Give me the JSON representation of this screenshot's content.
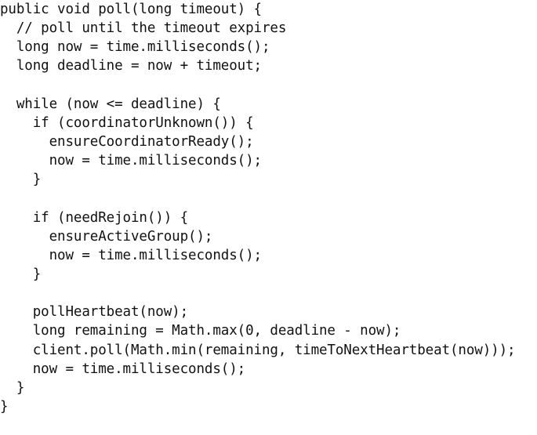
{
  "code": {
    "language": "java",
    "lines": [
      "public void poll(long timeout) {",
      "  // poll until the timeout expires",
      "  long now = time.milliseconds();",
      "  long deadline = now + timeout;",
      "",
      "  while (now <= deadline) {",
      "    if (coordinatorUnknown()) {",
      "      ensureCoordinatorReady();",
      "      now = time.milliseconds();",
      "    }",
      "",
      "    if (needRejoin()) {",
      "      ensureActiveGroup();",
      "      now = time.milliseconds();",
      "    }",
      "",
      "    pollHeartbeat(now);",
      "    long remaining = Math.max(0, deadline - now);",
      "    client.poll(Math.min(remaining, timeToNextHeartbeat(now)));",
      "    now = time.milliseconds();",
      "  }",
      "}"
    ]
  }
}
